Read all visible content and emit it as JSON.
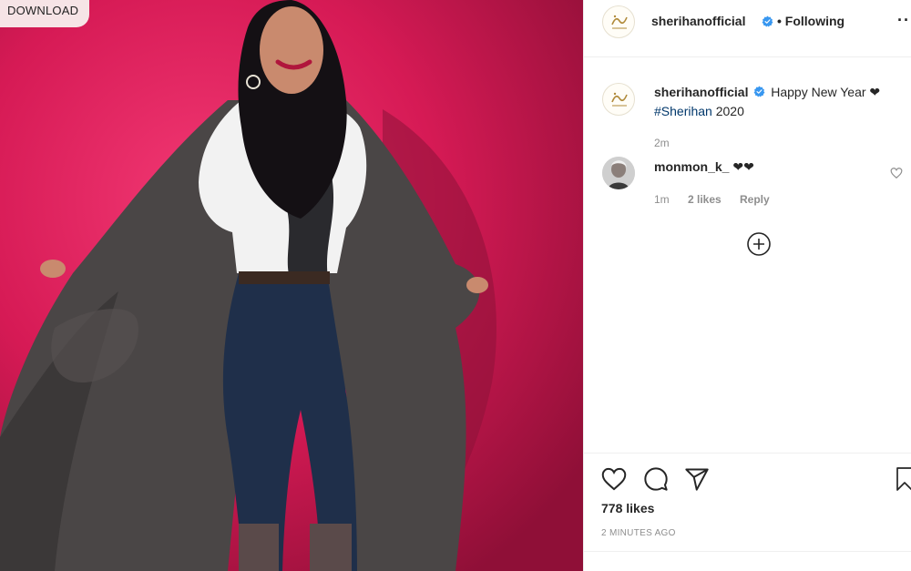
{
  "download_label": "DOWNLOAD",
  "post": {
    "username": "sherihanofficial",
    "following_label": "• Following",
    "more_label": "··",
    "caption_text": "Happy New Year ❤",
    "hashtag": "#Sherihan",
    "year": " 2020",
    "caption_time": "2m"
  },
  "comment": {
    "username": "monmon_k_",
    "text": "❤❤",
    "time": "1m",
    "likes": "2 likes",
    "reply_label": "Reply"
  },
  "likes_count": "778 likes",
  "time_ago": "2 MINUTES AGO",
  "colors": {
    "background_magenta": "#d81b55",
    "verified_blue": "#3897f0",
    "hashtag_blue": "#00376b",
    "muted_gray": "#8e8e8e"
  },
  "icons": [
    "verified-badge-icon",
    "heart-outline-icon",
    "comment-bubble-icon",
    "share-plane-icon",
    "bookmark-icon",
    "plus-circle-icon"
  ]
}
